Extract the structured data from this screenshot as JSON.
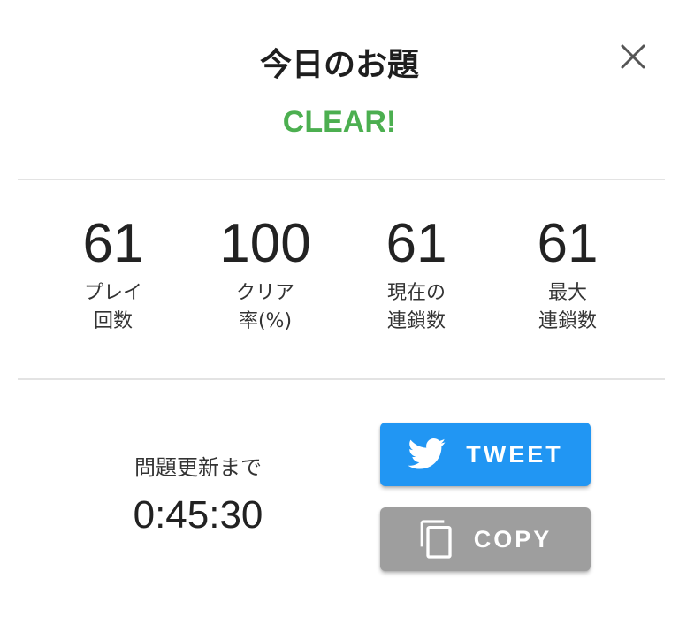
{
  "dialog": {
    "title": "今日のお題",
    "result": "CLEAR!"
  },
  "colors": {
    "result": "#4caf50",
    "tweet_button": "#2196f3",
    "copy_button": "#9e9e9e"
  },
  "stats": [
    {
      "value": "61",
      "label_line1": "プレイ",
      "label_line2": "回数"
    },
    {
      "value": "100",
      "label_line1": "クリア",
      "label_line2": "率(%)"
    },
    {
      "value": "61",
      "label_line1": "現在の",
      "label_line2": "連鎖数"
    },
    {
      "value": "61",
      "label_line1": "最大",
      "label_line2": "連鎖数"
    }
  ],
  "countdown": {
    "label": "問題更新まで",
    "value": "0:45:30"
  },
  "buttons": {
    "tweet": {
      "label": "TWEET",
      "icon": "twitter-bird-icon"
    },
    "copy": {
      "label": "COPY",
      "icon": "copy-icon"
    }
  },
  "icons": {
    "close": "close-icon"
  }
}
